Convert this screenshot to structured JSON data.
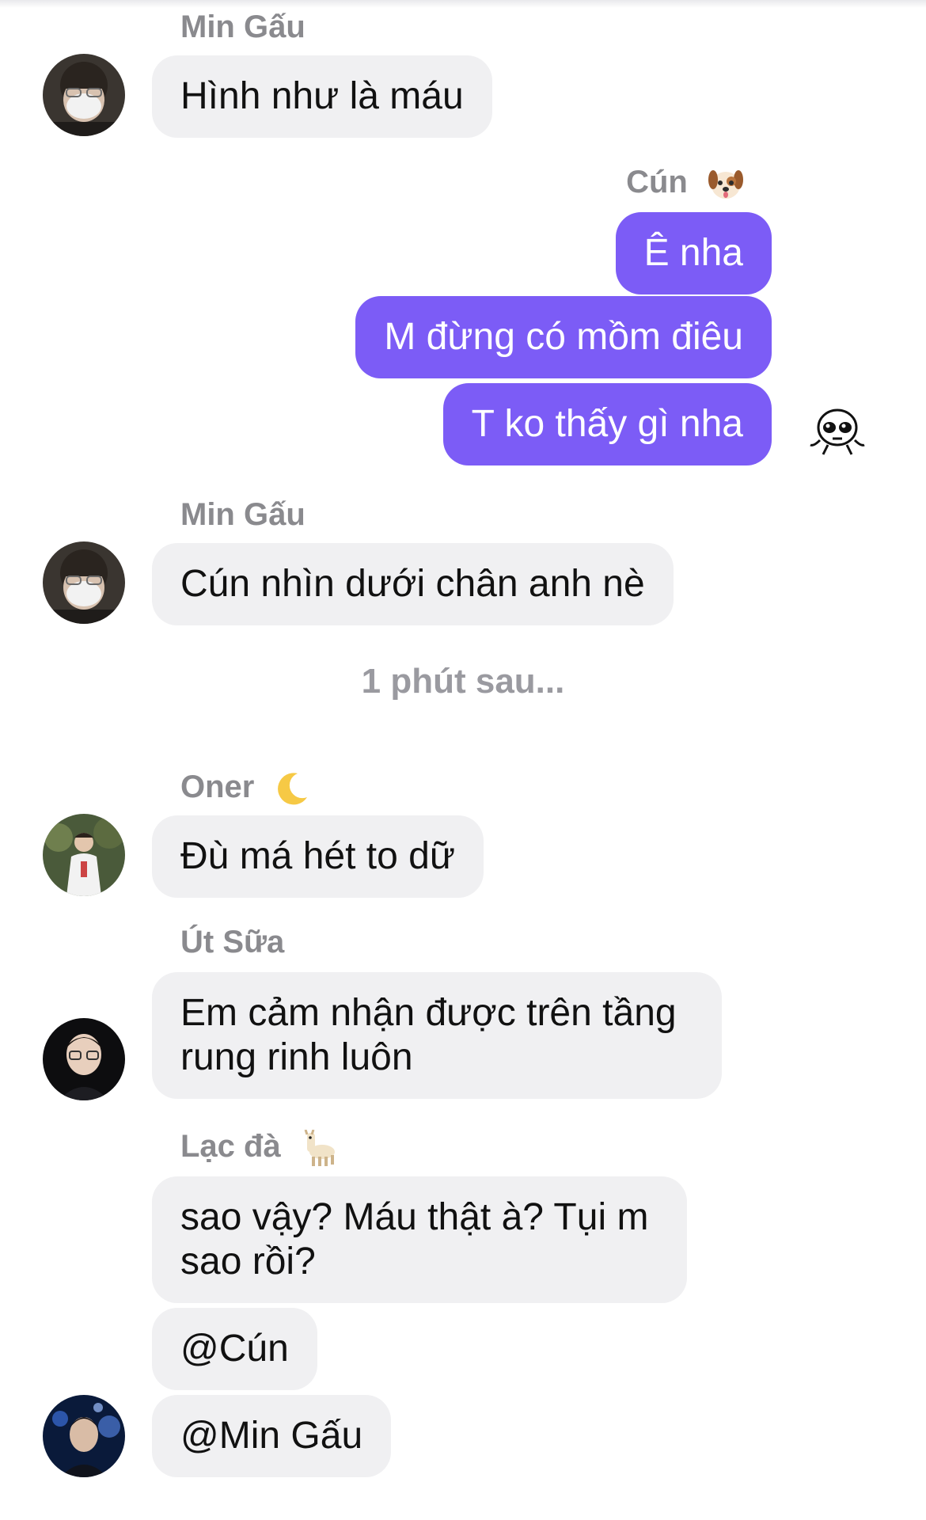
{
  "messages": {
    "m1": {
      "sender": "Min Gấu",
      "text": "Hình như là máu"
    },
    "m2": {
      "sender": "Cún",
      "sender_emoji": "dog-face-icon",
      "texts": [
        "Ê nha",
        "M đừng có mồm điêu",
        "T ko thấy gì nha"
      ],
      "reaction": "skull-sticker-icon"
    },
    "m3": {
      "sender": "Min Gấu",
      "text": "Cún nhìn dưới chân anh nè"
    },
    "divider": "1 phút sau...",
    "m4": {
      "sender": "Oner",
      "sender_emoji": "crescent-moon-icon",
      "text": "Đù má hét to dữ"
    },
    "m5": {
      "sender": "Út Sữa",
      "text": "Em cảm nhận được trên tầng rung rinh luôn"
    },
    "m6": {
      "sender": "Lạc đà",
      "sender_emoji": "llama-icon",
      "texts": [
        "sao vậy? Máu thật à? Tụi m sao rồi?",
        "@Cún",
        "@Min Gấu"
      ]
    }
  },
  "colors": {
    "outgoing_bubble": "#7c5cf6",
    "incoming_bubble": "#f0f0f2",
    "sender_name": "#8a8a8e"
  }
}
